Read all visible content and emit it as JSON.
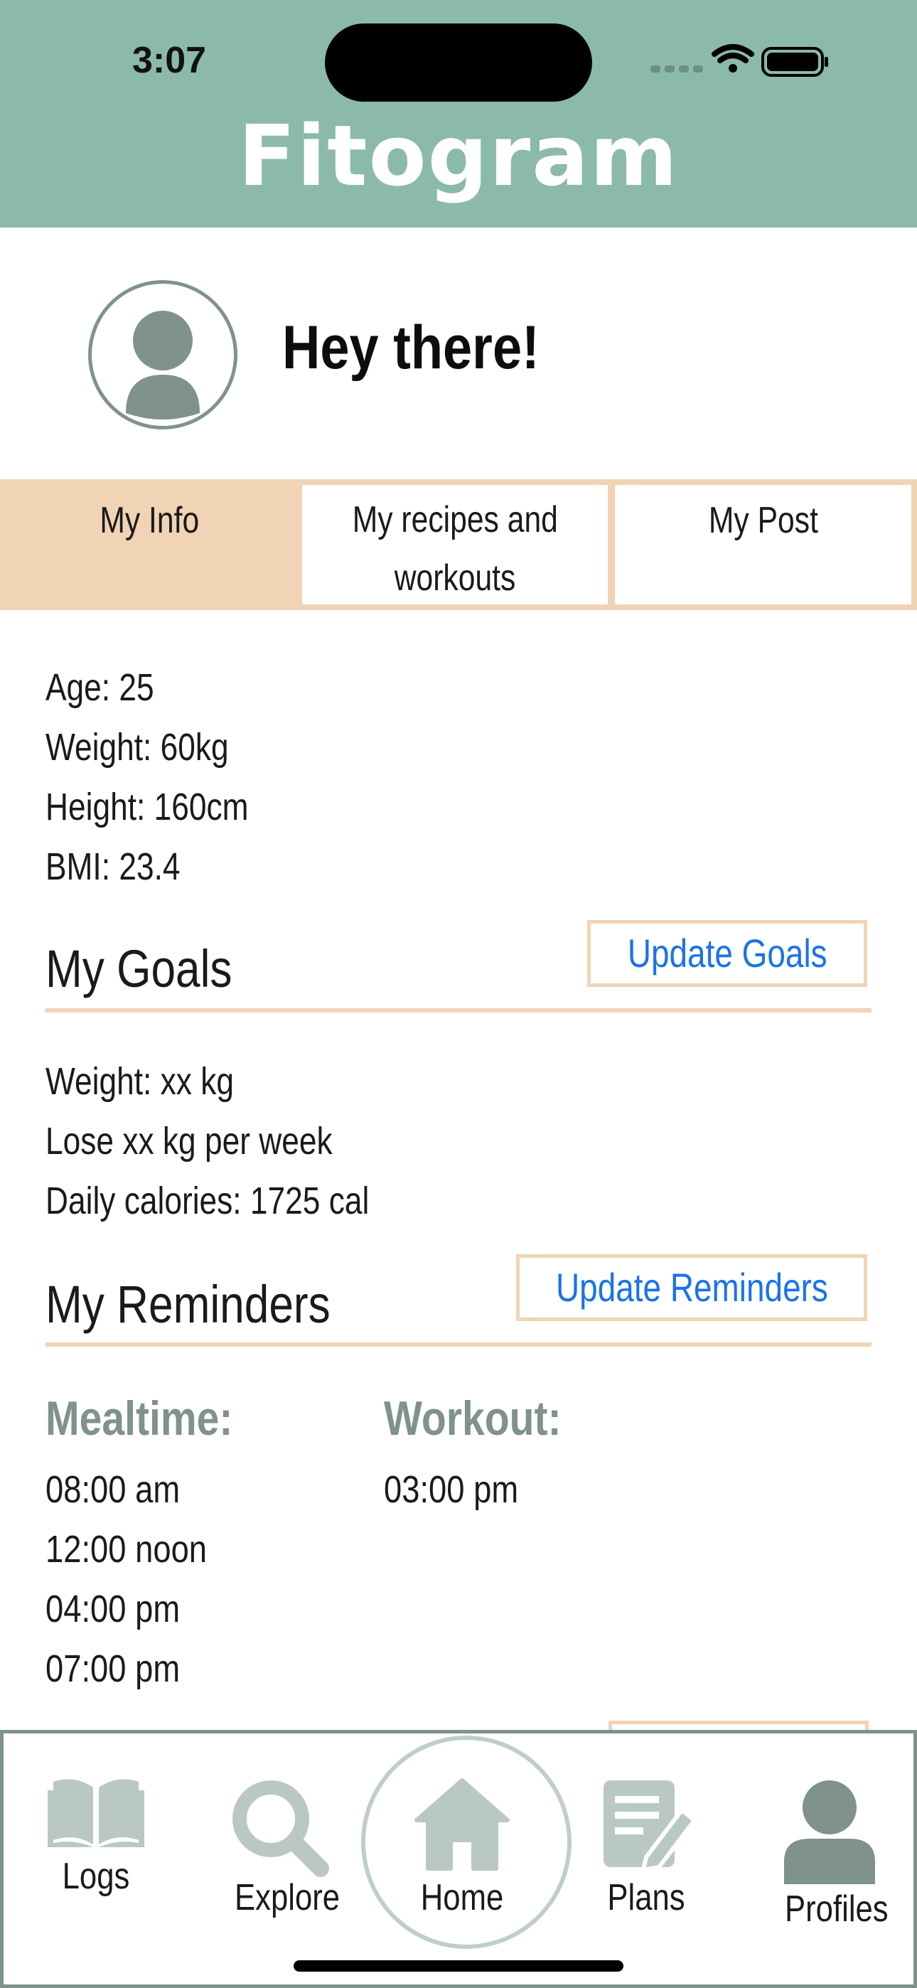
{
  "status_bar": {
    "time": "3:07"
  },
  "header": {
    "title": "Fitogram"
  },
  "profile": {
    "greeting": "Hey there!"
  },
  "tabs": [
    {
      "label": "My Info",
      "active": true
    },
    {
      "label_line1": "My recipes and",
      "label_line2": "workouts",
      "active": false
    },
    {
      "label": "My Post",
      "active": false
    }
  ],
  "info": {
    "age": "Age: 25",
    "weight": "Weight: 60kg",
    "height": "Height: 160cm",
    "bmi": "BMI: 23.4"
  },
  "goals": {
    "title": "My Goals",
    "button": "Update Goals",
    "lines": [
      "Weight: xx kg",
      "Lose xx kg per week",
      "Daily calories: 1725 cal"
    ]
  },
  "reminders": {
    "title": "My Reminders",
    "button": "Update Reminders",
    "mealtime_label": "Mealtime:",
    "mealtimes": [
      "08:00 am",
      "12:00 noon",
      "04:00 pm",
      "07:00 pm"
    ],
    "workout_label": "Workout:",
    "workouts": [
      "03:00 pm"
    ]
  },
  "tabbar": {
    "logs": "Logs",
    "explore": "Explore",
    "home": "Home",
    "plans": "Plans",
    "profiles": "Profiles"
  },
  "colors": {
    "header": "#8cbaa8",
    "accent_peach": "#f1d3b5",
    "muted_green": "#7f928c",
    "link_blue": "#1a73e8",
    "icon_inactive": "#b9c9c2"
  },
  "icons": [
    "signal-icon",
    "wifi-icon",
    "battery-icon",
    "avatar-icon",
    "book-icon",
    "search-icon",
    "home-icon",
    "notes-edit-icon",
    "profile-icon"
  ]
}
